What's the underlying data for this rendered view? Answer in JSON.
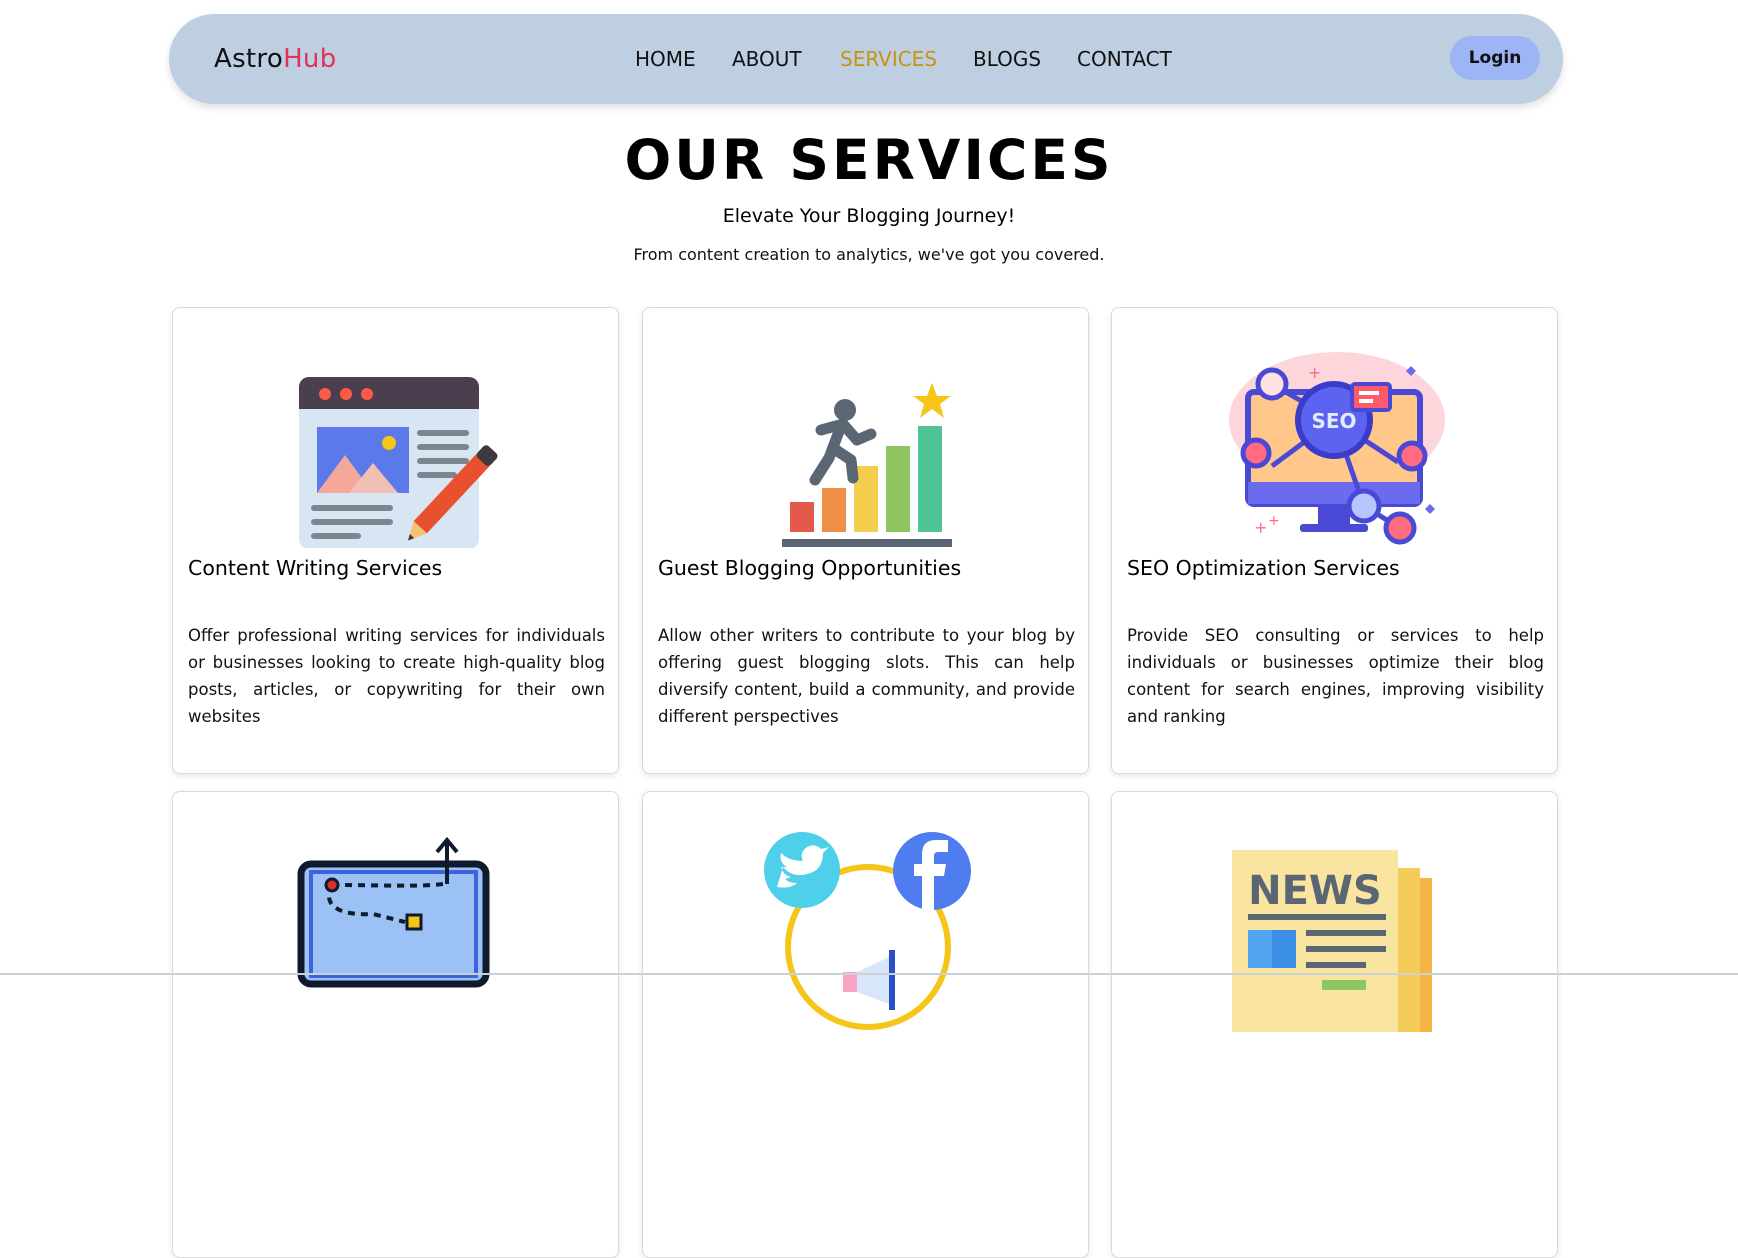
{
  "brand": {
    "name_part1": "Astro",
    "name_part2": "Hub",
    "accent_color": "#e03158"
  },
  "nav": {
    "items": [
      {
        "label": "HOME",
        "active": false
      },
      {
        "label": "ABOUT",
        "active": false
      },
      {
        "label": "SERVICES",
        "active": true
      },
      {
        "label": "BLOGS",
        "active": false
      },
      {
        "label": "CONTACT",
        "active": false
      }
    ],
    "active_color": "#c79312",
    "login_label": "Login"
  },
  "hero": {
    "title": "OUR SERVICES",
    "subtitle": "Elevate Your Blogging Journey!",
    "description": "From content creation to analytics, we've got you covered."
  },
  "cards": [
    {
      "title": "Content Writing Services",
      "text": "Offer professional writing services for individuals or businesses looking to create high-quality blog posts, articles, or copywriting for their own websites",
      "icon": "content-writing-illustration"
    },
    {
      "title": "Guest Blogging Opportunities",
      "text": "Allow other writers to contribute to your blog by offering guest blogging slots. This can help diversify content, build a community, and provide different perspectives",
      "icon": "growth-chart-illustration"
    },
    {
      "title": "SEO Optimization Services",
      "text": "Provide SEO consulting or services to help individuals or businesses optimize their blog content for search engines, improving visibility and ranking",
      "icon": "seo-monitor-illustration"
    },
    {
      "title": "",
      "text": "",
      "icon": "strategy-map-illustration"
    },
    {
      "title": "",
      "text": "",
      "icon": "social-media-illustration"
    },
    {
      "title": "",
      "text": "",
      "icon": "newspaper-illustration",
      "icon_text": "NEWS"
    }
  ],
  "colors": {
    "navbar_bg": "#bfcfe2",
    "login_bg": "#9db4f5"
  }
}
